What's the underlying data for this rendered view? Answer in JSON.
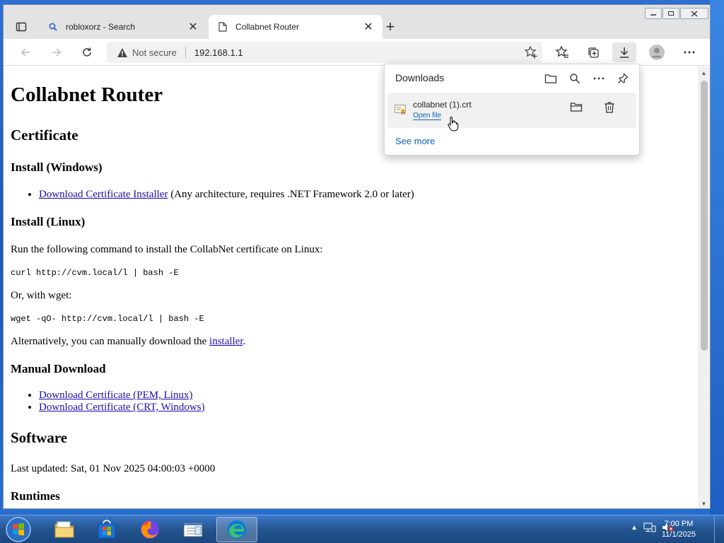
{
  "browser": {
    "tabs": [
      {
        "label": "robloxorz - Search",
        "close": "✕"
      },
      {
        "label": "Collabnet Router",
        "close": "✕"
      }
    ],
    "new_tab": "+",
    "address": {
      "security": "Not secure",
      "url": "192.168.1.1"
    }
  },
  "downloads": {
    "title": "Downloads",
    "item": {
      "filename": "collabnet (1).crt",
      "action": "Open file"
    },
    "see_more": "See more"
  },
  "page": {
    "h1": "Collabnet Router",
    "certificate_heading": "Certificate",
    "install_windows_heading": "Install (Windows)",
    "install_windows_link": "Download Certificate Installer",
    "install_windows_note": " (Any architecture, requires .NET Framework 2.0 or later)",
    "install_linux_heading": "Install (Linux)",
    "linux_intro": "Run the following command to install the CollabNet certificate on Linux:",
    "curl_cmd": "curl http://cvm.local/l | bash -E",
    "wget_intro": "Or, with wget:",
    "wget_cmd": "wget -qO- http://cvm.local/l | bash -E",
    "manual_pre": "Alternatively, you can manually download the ",
    "manual_link": "installer",
    "manual_post": ".",
    "manual_heading": "Manual Download",
    "pem_link": "Download Certificate (PEM, Linux)",
    "crt_link": "Download Certificate (CRT, Windows)",
    "software_heading": "Software",
    "last_updated": "Last updated: Sat, 01 Nov 2025 04:00:03 +0000",
    "runtimes_heading": "Runtimes"
  },
  "taskbar": {
    "time": "7:00 PM",
    "date": "11/1/2025"
  }
}
